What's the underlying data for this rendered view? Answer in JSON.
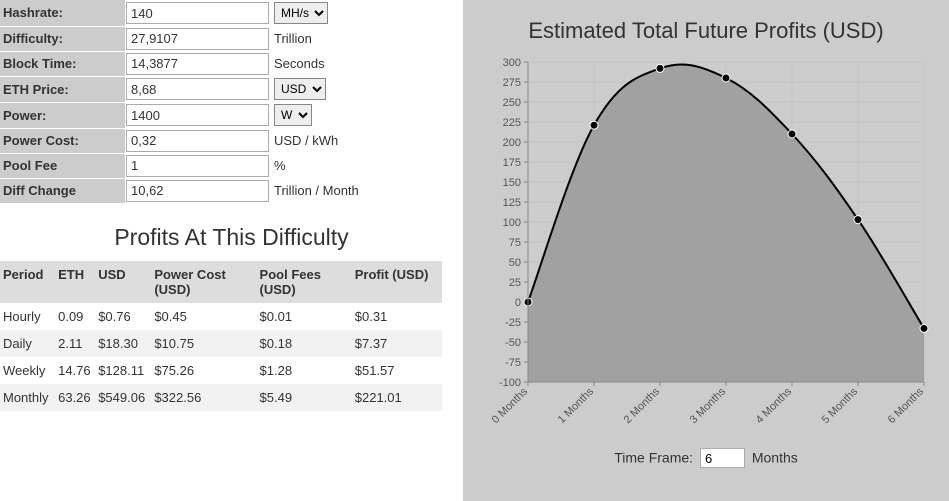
{
  "params": {
    "rows": [
      {
        "label": "Hashrate:",
        "value": "140",
        "unit_type": "select",
        "options": [
          "MH/s"
        ],
        "selected": "MH/s"
      },
      {
        "label": "Difficulty:",
        "value": "27,9107",
        "unit_type": "text",
        "unit": "Trillion"
      },
      {
        "label": "Block Time:",
        "value": "14,3877",
        "unit_type": "text",
        "unit": "Seconds"
      },
      {
        "label": "ETH Price:",
        "value": "8,68",
        "unit_type": "select",
        "options": [
          "USD"
        ],
        "selected": "USD"
      },
      {
        "label": "Power:",
        "value": "1400",
        "unit_type": "select",
        "options": [
          "W"
        ],
        "selected": "W"
      },
      {
        "label": "Power Cost:",
        "value": "0,32",
        "unit_type": "text",
        "unit": "USD / kWh"
      },
      {
        "label": "Pool Fee",
        "value": "1",
        "unit_type": "text",
        "unit": "%"
      },
      {
        "label": "Diff Change",
        "value": "10,62",
        "unit_type": "text",
        "unit": "Trillion / Month"
      }
    ]
  },
  "profits_title": "Profits At This Difficulty",
  "profits": {
    "headers": [
      "Period",
      "ETH",
      "USD",
      "Power Cost (USD)",
      "Pool Fees (USD)",
      "Profit (USD)"
    ],
    "rows": [
      {
        "period": "Hourly",
        "eth": "0.09",
        "usd": "$0.76",
        "power": "$0.45",
        "fees": "$0.01",
        "profit": "$0.31"
      },
      {
        "period": "Daily",
        "eth": "2.11",
        "usd": "$18.30",
        "power": "$10.75",
        "fees": "$0.18",
        "profit": "$7.37"
      },
      {
        "period": "Weekly",
        "eth": "14.76",
        "usd": "$128.11",
        "power": "$75.26",
        "fees": "$1.28",
        "profit": "$51.57"
      },
      {
        "period": "Monthly",
        "eth": "63.26",
        "usd": "$549.06",
        "power": "$322.56",
        "fees": "$5.49",
        "profit": "$221.01"
      }
    ]
  },
  "chart_title": "Estimated Total Future Profits (USD)",
  "timeframe": {
    "label_before": "Time Frame:",
    "value": "6",
    "label_after": "Months"
  },
  "chart_data": {
    "type": "area",
    "title": "Estimated Total Future Profits (USD)",
    "xlabel": "",
    "ylabel": "",
    "categories": [
      "0 Months",
      "1 Months",
      "2 Months",
      "3 Months",
      "4 Months",
      "5 Months",
      "6 Months"
    ],
    "values": [
      0,
      221,
      292,
      280,
      210,
      103,
      -33
    ],
    "ylim": [
      -100,
      300
    ],
    "yticks": [
      -100,
      -75,
      -50,
      -25,
      0,
      25,
      50,
      75,
      100,
      125,
      150,
      175,
      200,
      225,
      250,
      275,
      300
    ]
  }
}
